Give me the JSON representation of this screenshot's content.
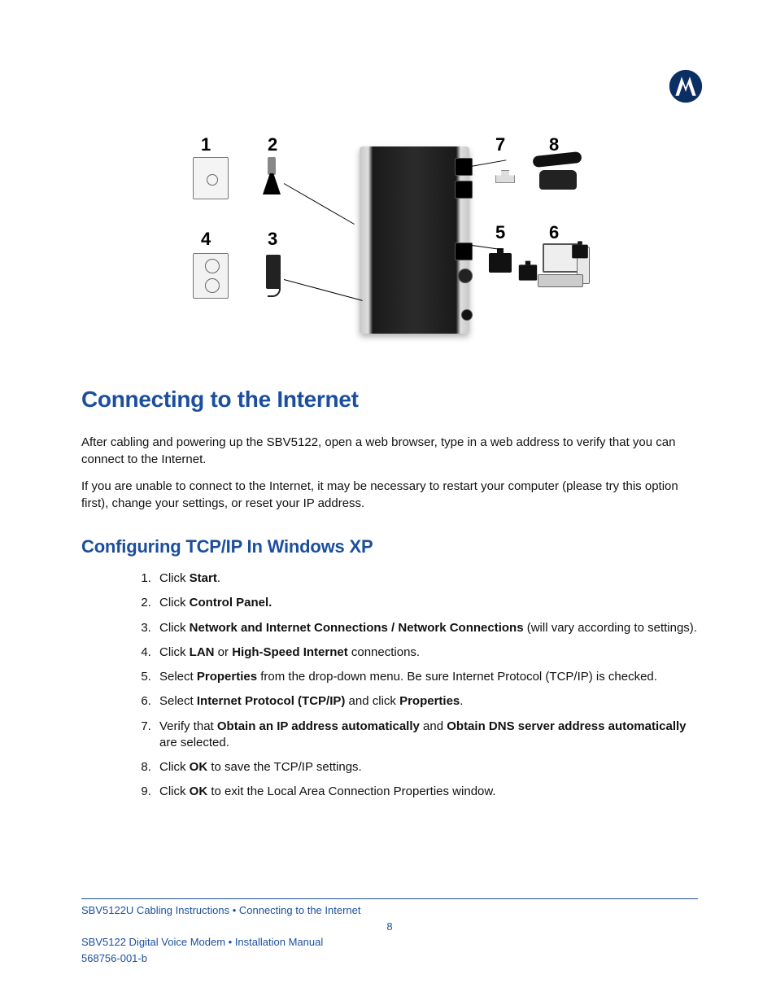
{
  "logo_name": "motorola-logo",
  "diagram": {
    "labels": [
      "1",
      "2",
      "3",
      "4",
      "5",
      "6",
      "7",
      "8"
    ]
  },
  "heading1": "Connecting to the Internet",
  "para1": "After cabling and powering up the SBV5122, open a web browser, type in a web address to verify that you can connect to the Internet.",
  "para2": " If you are unable to connect to the Internet, it may be necessary to restart your computer (please try this option first), change your settings, or reset your IP address.",
  "heading2": "Configuring TCP/IP In Windows XP",
  "steps": [
    {
      "pre": "Click ",
      "b": "Start",
      "post": "."
    },
    {
      "pre": "Click ",
      "b": "Control Panel.",
      "post": ""
    },
    {
      "pre": "Click ",
      "b": "Network and Internet Connections / Network Connections",
      "post": " (will vary according to settings)."
    },
    {
      "pre": "Click ",
      "b": "LAN",
      "mid": " or ",
      "b2": "High-Speed Internet",
      "post": " connections."
    },
    {
      "pre": "Select ",
      "b": "Properties",
      "post": " from the drop-down menu. Be sure Internet Protocol (TCP/IP) is checked."
    },
    {
      "pre": "Select ",
      "b": "Internet Protocol (TCP/IP)",
      "mid": " and click ",
      "b2": "Properties",
      "post": "."
    },
    {
      "pre": "Verify that ",
      "b": "Obtain an IP address automatically",
      "mid": " and ",
      "b2": "Obtain DNS server address automatically",
      "post": " are selected."
    },
    {
      "pre": "Click ",
      "b": "OK",
      "post": " to save the TCP/IP settings."
    },
    {
      "pre": "Click ",
      "b": "OK",
      "post": " to exit the Local Area Connection Properties window."
    }
  ],
  "footer": {
    "line1": "SBV5122U Cabling Instructions • Connecting to the Internet",
    "page": "8",
    "line2": "SBV5122 Digital Voice Modem  • Installation Manual",
    "line3": "568756-001-b"
  }
}
